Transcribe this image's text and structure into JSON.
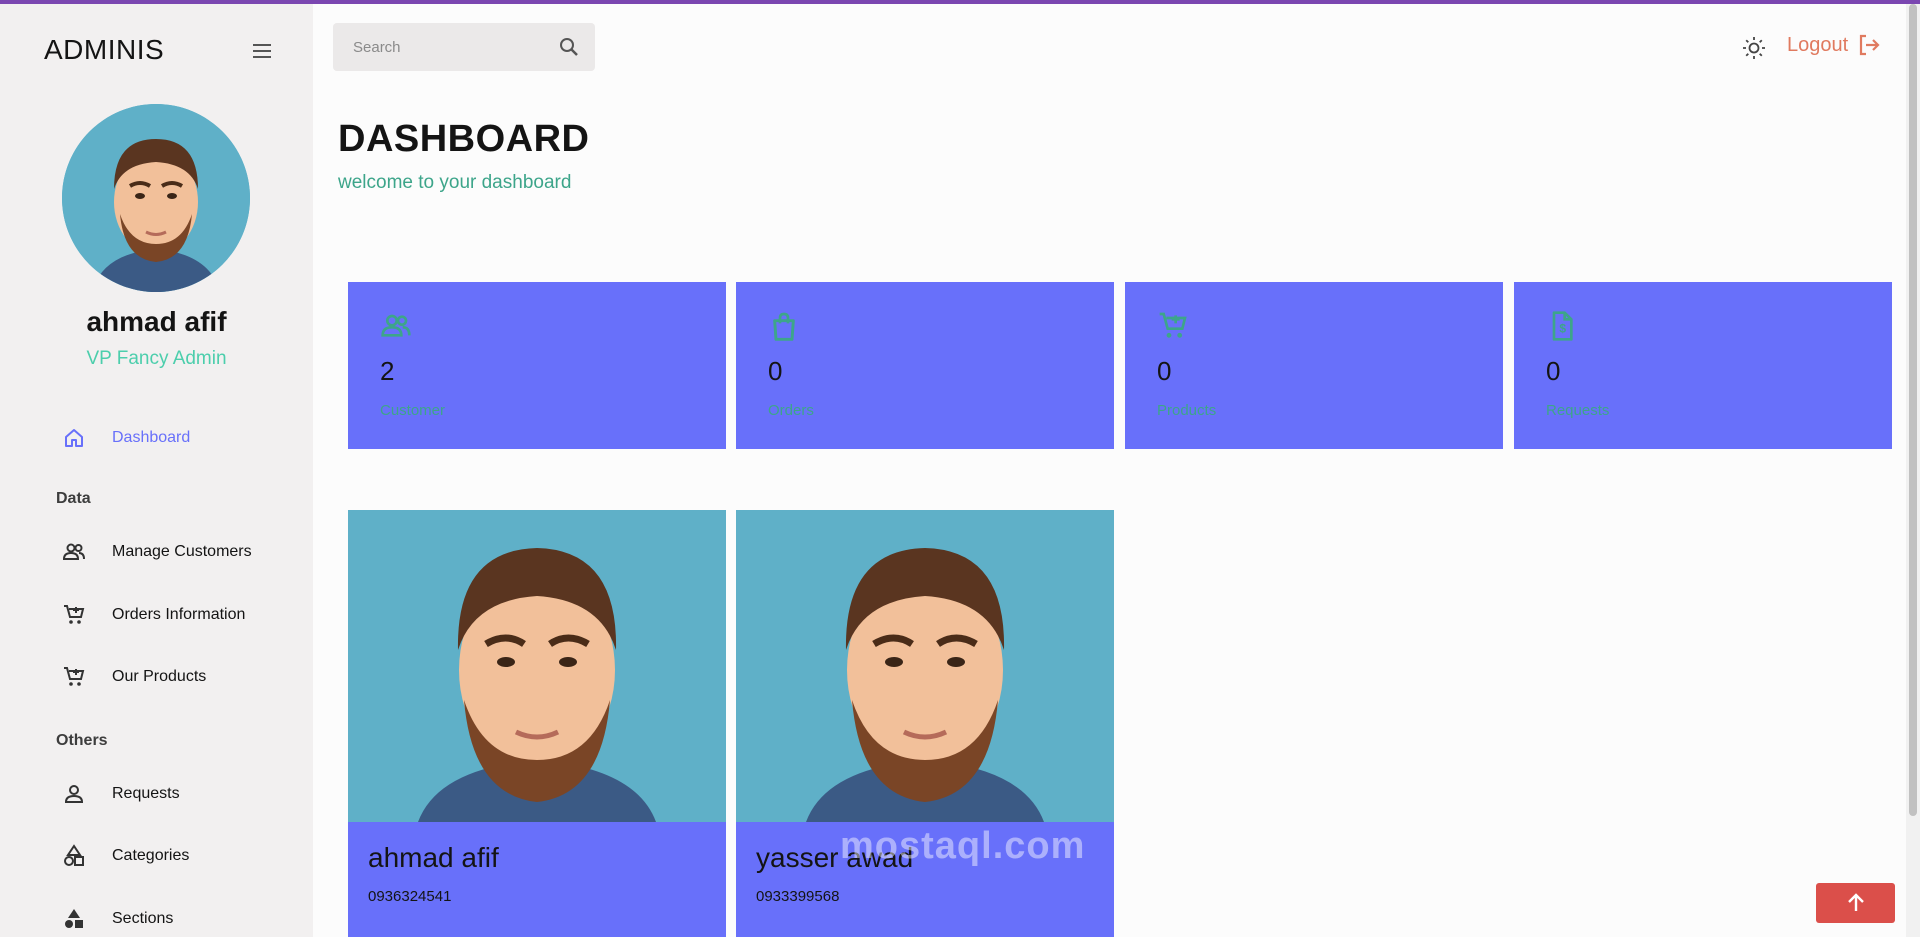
{
  "sidebar": {
    "brand": "ADMINIS",
    "user": {
      "name": "ahmad afif",
      "role": "VP Fancy Admin"
    },
    "items": [
      {
        "label": "Dashboard",
        "icon": "home-icon",
        "active": true
      },
      {
        "label": "Manage Customers",
        "icon": "people-icon"
      },
      {
        "label": "Orders Information",
        "icon": "cart-icon"
      },
      {
        "label": "Our Products",
        "icon": "cart-add-icon"
      },
      {
        "label": "Requests",
        "icon": "person-icon"
      },
      {
        "label": "Categories",
        "icon": "shapes-icon"
      },
      {
        "label": "Sections",
        "icon": "category-icon"
      }
    ],
    "sections": [
      "Data",
      "Others"
    ]
  },
  "topbar": {
    "search_placeholder": "Search",
    "search_value": "",
    "logout_label": "Logout"
  },
  "header": {
    "title": "DASHBOARD",
    "subtitle": "welcome to your dashboard"
  },
  "stats": [
    {
      "value": "2",
      "label": "Customer",
      "icon": "people-icon"
    },
    {
      "value": "0",
      "label": "Orders",
      "icon": "shopping-bag-icon"
    },
    {
      "value": "0",
      "label": "Products",
      "icon": "cart-add-icon"
    },
    {
      "value": "0",
      "label": "Requests",
      "icon": "invoice-icon"
    }
  ],
  "people": [
    {
      "name": "ahmad afif",
      "phone": "0936324541"
    },
    {
      "name": "yasser awad",
      "phone": "0933399568"
    }
  ],
  "watermark": "mostaql.com",
  "colors": {
    "accent": "#6870fa",
    "green": "#3da58a",
    "logout": "#e07a5f",
    "scroll_top": "#db4f4a",
    "top_border": "#7b47b1"
  }
}
